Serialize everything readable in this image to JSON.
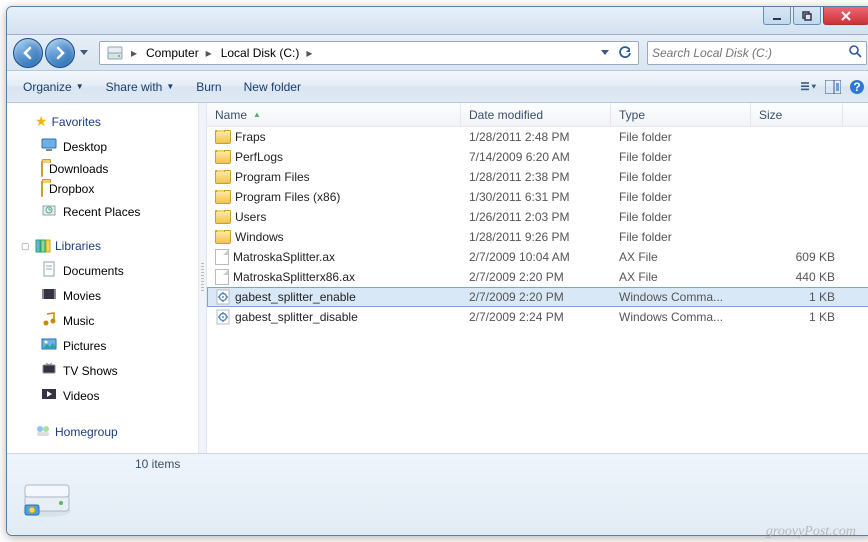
{
  "breadcrumb": {
    "seg1": "Computer",
    "seg2": "Local Disk (C:)"
  },
  "search": {
    "placeholder": "Search Local Disk (C:)"
  },
  "toolbar": {
    "organize": "Organize",
    "share": "Share with",
    "burn": "Burn",
    "newfolder": "New folder"
  },
  "nav": {
    "favorites": "Favorites",
    "fav_items": [
      "Desktop",
      "Downloads",
      "Dropbox",
      "Recent Places"
    ],
    "libraries": "Libraries",
    "lib_items": [
      "Documents",
      "Movies",
      "Music",
      "Pictures",
      "TV Shows",
      "Videos"
    ],
    "homegroup": "Homegroup"
  },
  "columns": {
    "name": "Name",
    "date": "Date modified",
    "type": "Type",
    "size": "Size"
  },
  "rows": [
    {
      "icon": "folder",
      "name": "Fraps",
      "date": "1/28/2011 2:48 PM",
      "type": "File folder",
      "size": ""
    },
    {
      "icon": "folder",
      "name": "PerfLogs",
      "date": "7/14/2009 6:20 AM",
      "type": "File folder",
      "size": ""
    },
    {
      "icon": "folder",
      "name": "Program Files",
      "date": "1/28/2011 2:38 PM",
      "type": "File folder",
      "size": ""
    },
    {
      "icon": "folder",
      "name": "Program Files (x86)",
      "date": "1/30/2011 6:31 PM",
      "type": "File folder",
      "size": ""
    },
    {
      "icon": "folder",
      "name": "Users",
      "date": "1/26/2011 2:03 PM",
      "type": "File folder",
      "size": ""
    },
    {
      "icon": "folder",
      "name": "Windows",
      "date": "1/28/2011 9:26 PM",
      "type": "File folder",
      "size": ""
    },
    {
      "icon": "file",
      "name": "MatroskaSplitter.ax",
      "date": "2/7/2009 10:04 AM",
      "type": "AX File",
      "size": "609 KB"
    },
    {
      "icon": "file",
      "name": "MatroskaSplitterx86.ax",
      "date": "2/7/2009 2:20 PM",
      "type": "AX File",
      "size": "440 KB"
    },
    {
      "icon": "cmd",
      "name": "gabest_splitter_enable",
      "date": "2/7/2009 2:20 PM",
      "type": "Windows Comma...",
      "size": "1 KB",
      "selected": true
    },
    {
      "icon": "cmd",
      "name": "gabest_splitter_disable",
      "date": "2/7/2009 2:24 PM",
      "type": "Windows Comma...",
      "size": "1 KB"
    }
  ],
  "status": {
    "count": "10 items"
  },
  "watermark": "groovyPost.com"
}
